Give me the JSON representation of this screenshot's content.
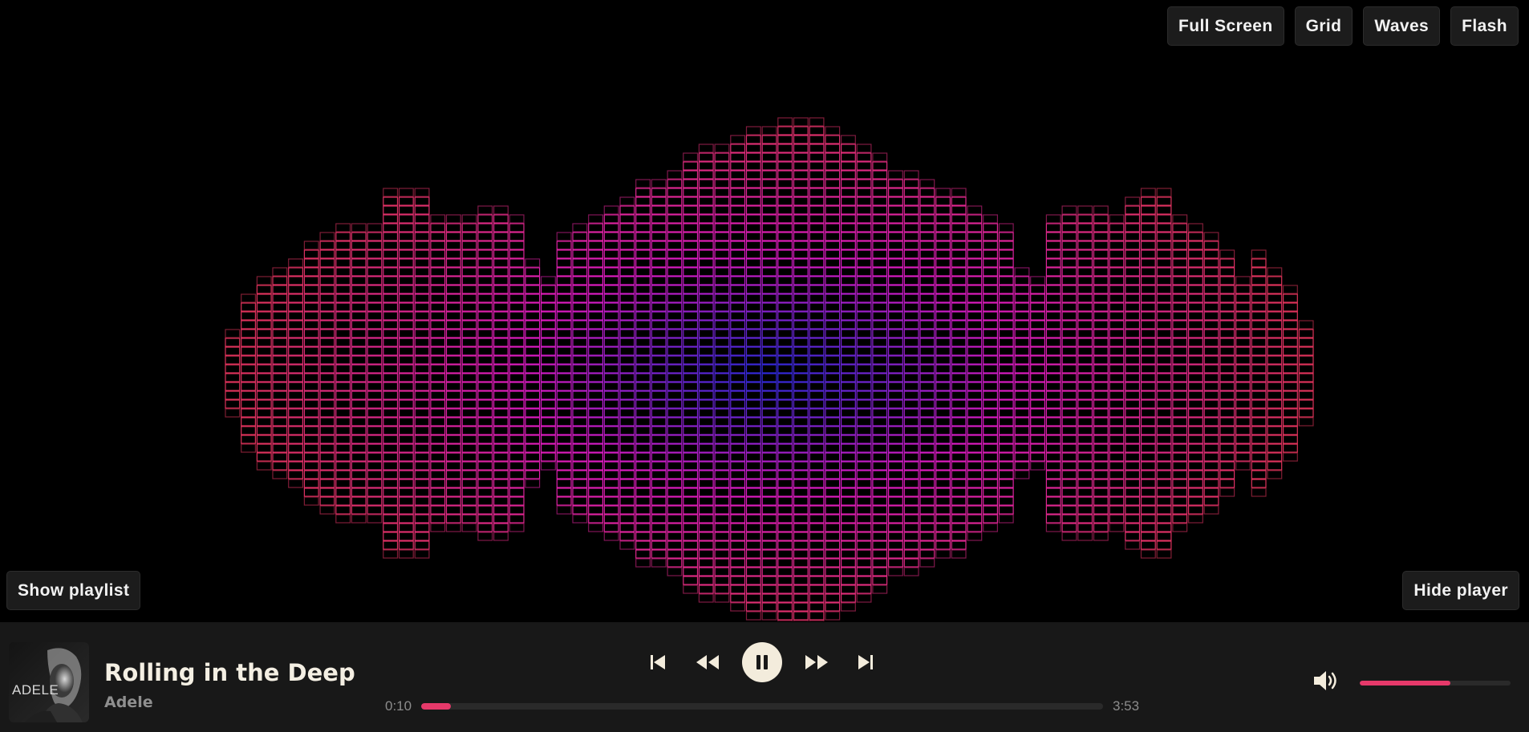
{
  "mode_buttons": [
    {
      "label": "Full Screen"
    },
    {
      "label": "Grid"
    },
    {
      "label": "Waves"
    },
    {
      "label": "Flash"
    }
  ],
  "show_playlist_label": "Show playlist",
  "hide_player_label": "Hide player",
  "track": {
    "title": "Rolling in the Deep",
    "artist": "Adele",
    "album_art_text": "ADELE"
  },
  "playback": {
    "state": "playing",
    "current_time": "0:10",
    "duration": "3:53",
    "progress": 0.043
  },
  "volume": {
    "level": 0.6
  },
  "controls": {
    "prev_icon": "skip-previous-icon",
    "rewind_icon": "rewind-icon",
    "pause_icon": "pause-icon",
    "forward_icon": "fast-forward-icon",
    "next_icon": "skip-next-icon",
    "volume_icon": "volume-high-icon"
  },
  "colors": {
    "accent": "#e6396a",
    "viz_outer": "#e8365c",
    "viz_mid": "#e91ccc",
    "viz_center": "#2a2ce6",
    "button_bg": "#1c1c1c",
    "player_bg": "#181818"
  },
  "visualizer_levels": [
    0.18,
    0.32,
    0.38,
    0.42,
    0.46,
    0.52,
    0.55,
    0.58,
    0.58,
    0.58,
    0.72,
    0.72,
    0.72,
    0.64,
    0.64,
    0.62,
    0.68,
    0.68,
    0.64,
    0.45,
    0.4,
    0.56,
    0.6,
    0.64,
    0.68,
    0.7,
    0.78,
    0.78,
    0.82,
    0.86,
    0.9,
    0.9,
    0.94,
    0.97,
    0.99,
    1.0,
    1.0,
    1.0,
    0.97,
    0.94,
    0.9,
    0.86,
    0.82,
    0.82,
    0.78,
    0.74,
    0.72,
    0.68,
    0.64,
    0.58,
    0.42,
    0.4,
    0.64,
    0.68,
    0.68,
    0.66,
    0.62,
    0.7,
    0.72,
    0.72,
    0.62,
    0.58,
    0.56,
    0.5,
    0.4,
    0.48,
    0.42,
    0.34,
    0.22
  ]
}
